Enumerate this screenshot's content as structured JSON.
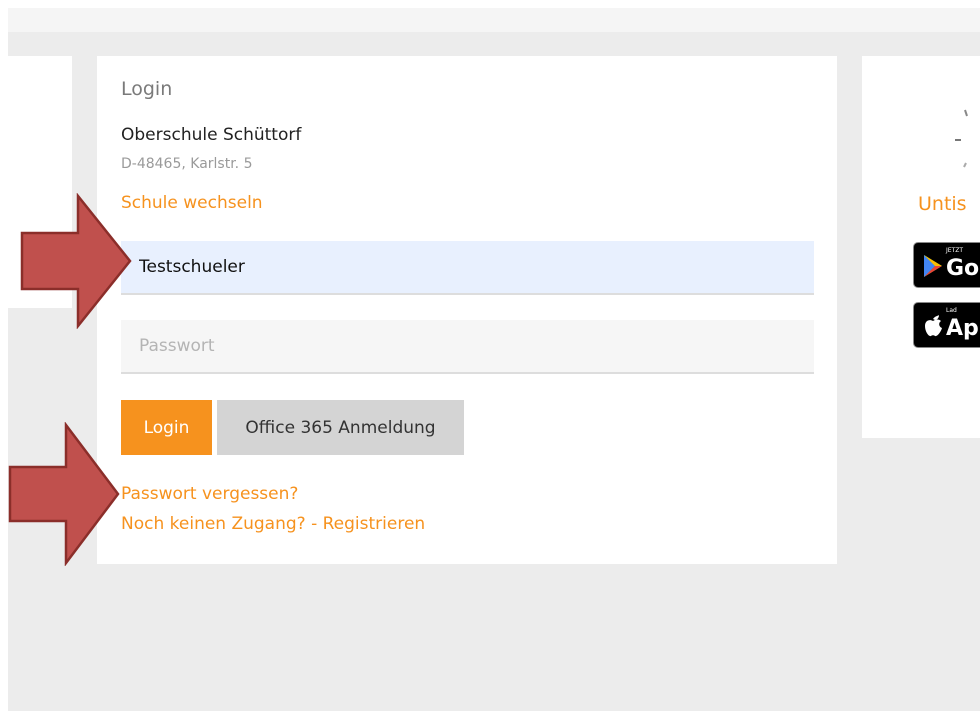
{
  "login_card": {
    "title": "Login",
    "school_name": "Oberschule Schüttorf",
    "school_address": "D-48465, Karlstr. 5",
    "switch_school_link": "Schule wechseln",
    "username_value": "Testschueler",
    "password_placeholder": "Passwort",
    "login_button": "Login",
    "office_button": "Office 365 Anmeldung",
    "forgot_password_link": "Passwort vergessen?",
    "register_link": "Noch keinen Zugang? - Registrieren"
  },
  "app_card": {
    "heading": "Untis",
    "google_play": {
      "small": "JETZT",
      "big": "Go"
    },
    "app_store": {
      "small": "Lad",
      "big": "Ap"
    }
  },
  "annotations": {
    "arrow_color": "#c0504d",
    "arrow_border": "#8b2e2a",
    "arrows": [
      "pointing-at-username",
      "pointing-at-forgot-password"
    ]
  },
  "colors": {
    "accent": "#f6921e",
    "background": "#ececec",
    "input_autofill": "#e8f0fe"
  }
}
